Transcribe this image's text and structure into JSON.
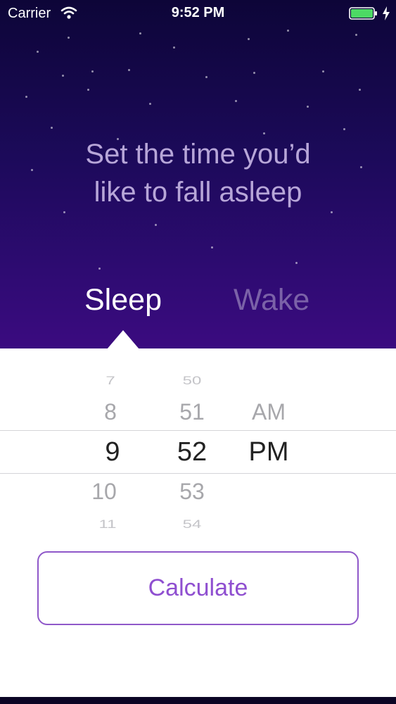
{
  "status_bar": {
    "carrier": "Carrier",
    "time": "9:52 PM",
    "icons": [
      "wifi-icon",
      "battery-icon",
      "charging-icon"
    ],
    "battery_color": "#4cd964"
  },
  "prompt": {
    "line1": "Set the time you’d",
    "line2": "like to fall asleep"
  },
  "tabs": [
    {
      "label": "Sleep",
      "selected": true
    },
    {
      "label": "Wake",
      "selected": false
    }
  ],
  "picker": {
    "hours": [
      "7",
      "8",
      "9",
      "10",
      "11"
    ],
    "minutes": [
      "50",
      "51",
      "52",
      "53",
      "54"
    ],
    "periods": [
      "AM",
      "PM"
    ],
    "selected": {
      "hour": "9",
      "minute": "52",
      "period": "PM"
    }
  },
  "calculate_label": "Calculate",
  "colors": {
    "sky_top": "#0d0538",
    "sky_bottom": "#3b0b80",
    "accent": "#8f4fd0",
    "prompt_text": "#b7a6d8",
    "inactive_tab": "#7b62a8"
  }
}
